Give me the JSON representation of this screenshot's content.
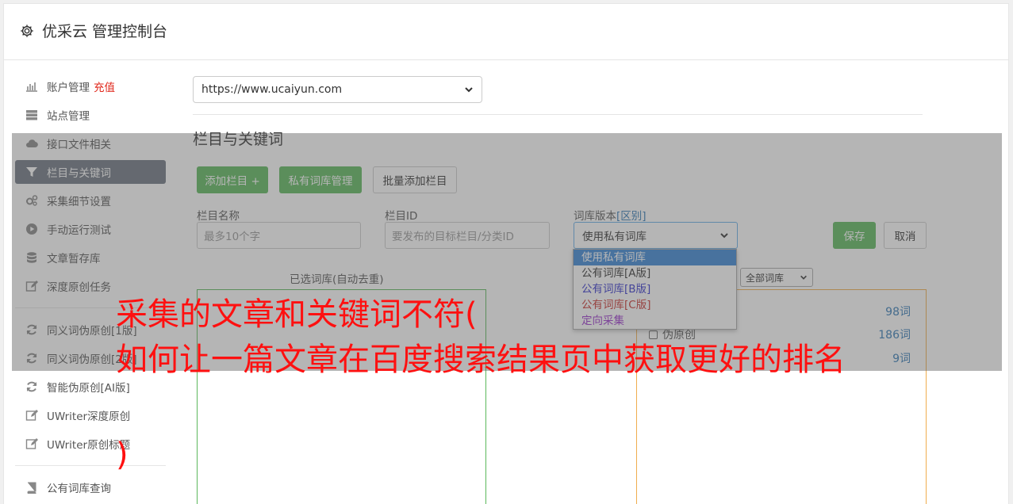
{
  "header": {
    "title": "优采云 管理控制台"
  },
  "sidebar": {
    "items": [
      {
        "label": "账户管理",
        "extra": "充值",
        "icon": "bar-chart-icon"
      },
      {
        "label": "站点管理",
        "icon": "server-icon"
      },
      {
        "label": "接口文件相关",
        "icon": "cloud-upload-icon"
      },
      {
        "label": "栏目与关键词",
        "icon": "filter-icon",
        "active": true
      },
      {
        "label": "采集细节设置",
        "icon": "gears-icon"
      },
      {
        "label": "手动运行测试",
        "icon": "play-circle-icon"
      },
      {
        "label": "文章暂存库",
        "icon": "database-icon"
      },
      {
        "label": "深度原创任务",
        "icon": "edit-icon"
      }
    ],
    "items2": [
      {
        "label": "同义词伪原创[1版]",
        "icon": "refresh-icon"
      },
      {
        "label": "同义词伪原创[2版]",
        "icon": "refresh-icon"
      },
      {
        "label": "智能伪原创[AI版]",
        "icon": "refresh-icon"
      },
      {
        "label": "UWriter深度原创",
        "icon": "edit-icon"
      },
      {
        "label": "UWriter原创标题",
        "icon": "edit-icon"
      }
    ],
    "items3": [
      {
        "label": "公有词库查询",
        "icon": "book-icon"
      }
    ]
  },
  "main": {
    "site_select": "https://www.ucaiyun.com",
    "section_title": "栏目与关键词",
    "buttons": {
      "add_column": "添加栏目 +",
      "private_lib": "私有词库管理",
      "batch_add": "批量添加栏目"
    },
    "form": {
      "name_label": "栏目名称",
      "name_placeholder": "最多10个字",
      "id_label": "栏目ID",
      "id_placeholder": "要发布的目标栏目/分类ID",
      "version_label": "词库版本",
      "version_link": "[区别]",
      "version_value": "使用私有词库",
      "save": "保存",
      "cancel": "取消"
    },
    "dropdown_options": [
      {
        "label": "使用私有词库",
        "color": "#ffffff",
        "selected": true
      },
      {
        "label": "公有词库[A版]",
        "color": "#333333"
      },
      {
        "label": "公有词库[B版]",
        "color": "#3333cc"
      },
      {
        "label": "公有词库[C版]",
        "color": "#c9302c"
      },
      {
        "label": "定向采集",
        "color": "#9933cc"
      }
    ],
    "selected_label": "已选词库(自动去重)",
    "filter_select": "全部词库",
    "lib_rows": [
      {
        "label": "",
        "count": "98词"
      },
      {
        "label": "伪原创",
        "count": "186词"
      },
      {
        "label": "",
        "count": "9词"
      }
    ]
  },
  "overlay_text": {
    "line1": "采集的文章和关键词不符(",
    "line2": "如何让一篇文章在百度搜索结果页中获取更好的排名",
    "line3": ")"
  }
}
